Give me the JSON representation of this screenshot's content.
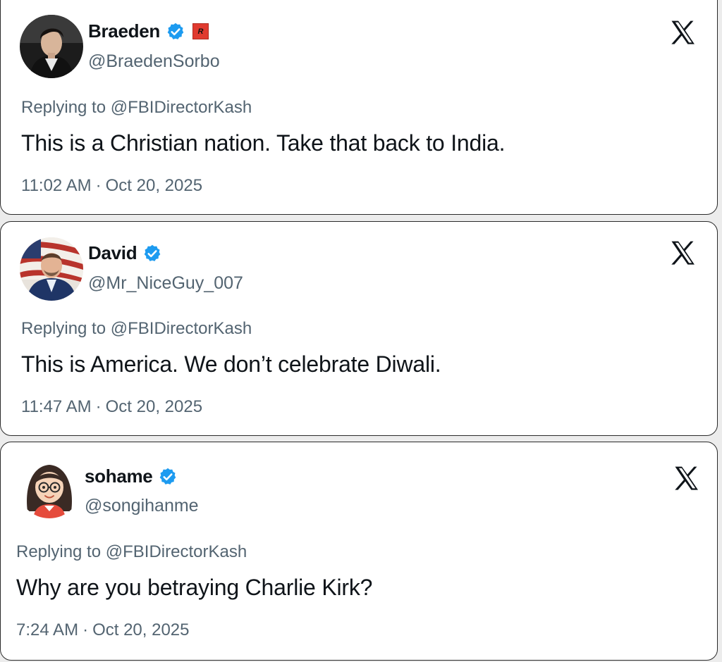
{
  "brand": {
    "verified_color": "#1d9bf0",
    "x_logo_color": "#0f1419"
  },
  "tweets": [
    {
      "display_name": "Braeden",
      "handle": "@BraedenSorbo",
      "verified": true,
      "extra_badge": "R",
      "replying_prefix": "Replying to",
      "replying_to": "@FBIDirectorKash",
      "text": "This is a Christian nation. Take that back to India.",
      "time": "11:02 AM",
      "date": "Oct 20, 2025",
      "avatar_icon": "man-dark-hair-avatar"
    },
    {
      "display_name": "David",
      "handle": "@Mr_NiceGuy_007",
      "verified": true,
      "replying_prefix": "Replying to",
      "replying_to": "@FBIDirectorKash",
      "text": "This is America. We don’t celebrate Diwali.",
      "time": "11:47 AM",
      "date": "Oct 20, 2025",
      "avatar_icon": "man-flag-background-avatar"
    },
    {
      "display_name": "sohame",
      "handle": "@songihanme",
      "verified": true,
      "replying_prefix": "Replying to",
      "replying_to": "@FBIDirectorKash",
      "text": "Why are you betraying Charlie Kirk?",
      "time": "7:24 AM",
      "date": "Oct 20, 2025",
      "avatar_icon": "cartoon-girl-glasses-avatar"
    }
  ]
}
